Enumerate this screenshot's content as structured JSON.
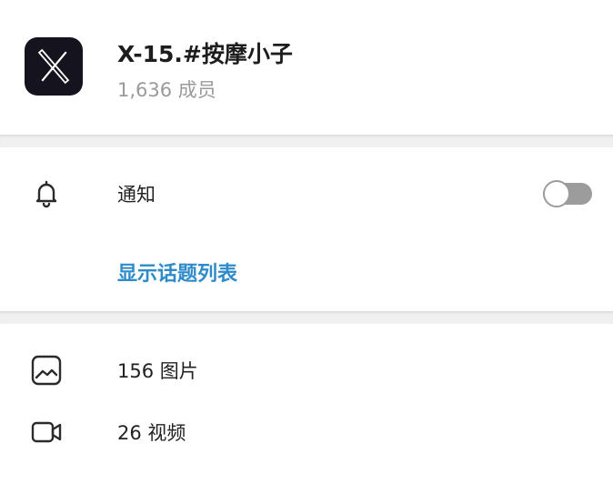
{
  "chat": {
    "avatar_icon": "x-logo-icon",
    "title": "X-15.#按摩小子",
    "members": "1,636 成员"
  },
  "notifications": {
    "icon": "bell-icon",
    "label": "通知",
    "enabled": false
  },
  "topics": {
    "link_label": "显示话题列表",
    "color": "#2e8bc9"
  },
  "media": {
    "items": [
      {
        "icon": "image-icon",
        "label": "156 图片"
      },
      {
        "icon": "video-icon",
        "label": "26 视频"
      }
    ]
  }
}
